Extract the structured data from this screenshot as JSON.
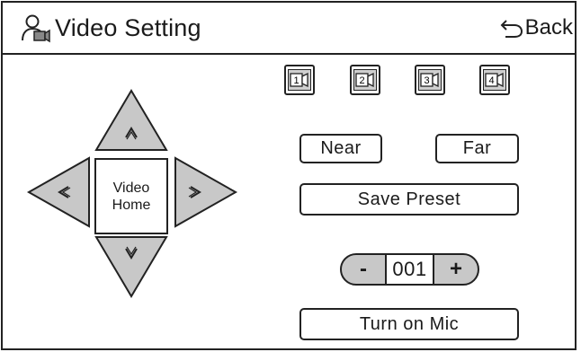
{
  "header": {
    "title": "Video Setting",
    "title_icon": "user-camera-icon",
    "back_label": "Back",
    "back_icon": "back-arrow-icon"
  },
  "cameras": [
    {
      "label": "1"
    },
    {
      "label": "2"
    },
    {
      "label": "3"
    },
    {
      "label": "4"
    }
  ],
  "controls": {
    "near_label": "Near",
    "far_label": "Far",
    "save_preset_label": "Save Preset",
    "turn_on_mic_label": "Turn on Mic"
  },
  "dpad": {
    "home_line1": "Video",
    "home_line2": "Home"
  },
  "preset": {
    "minus_label": "-",
    "value": "001",
    "plus_label": "+"
  },
  "colors": {
    "button_gray": "#c8c8c8",
    "border": "#222222"
  }
}
